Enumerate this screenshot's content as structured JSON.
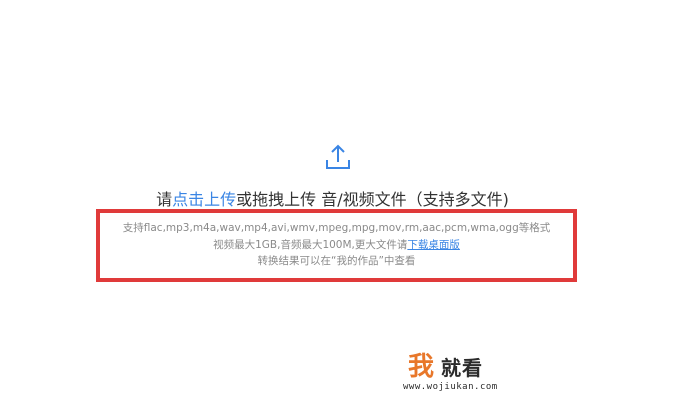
{
  "upload": {
    "icon": "upload-icon",
    "prefix": "请",
    "click_upload": "点击上传",
    "suffix": "或拖拽上传 音/视频文件（支持多文件)"
  },
  "info": {
    "formats": "支持flac,mp3,m4a,wav,mp4,avi,wmv,mpeg,mpg,mov,rm,aac,pcm,wma,ogg等格式",
    "limits": "视频最大1GB,音频最大100M,更大文件请",
    "download_link": "下载桌面版",
    "result_note": "转换结果可以在“我的作品”中查看"
  },
  "watermark": {
    "char1": "我",
    "chars_rest": "就看",
    "url": "www.wojiukan.com"
  },
  "colors": {
    "link": "#3a85e4",
    "highlight_border": "#e03a3a",
    "watermark_orange": "#e8772a"
  }
}
